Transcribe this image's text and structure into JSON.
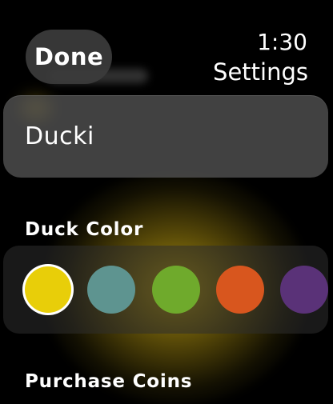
{
  "header": {
    "done_label": "Done",
    "time": "1:30",
    "title": "Settings"
  },
  "name_field": {
    "value": "Ducki"
  },
  "duck_color": {
    "label": "Duck Color",
    "selected_index": 0,
    "swatches": [
      {
        "name": "yellow",
        "color": "#E8CE09"
      },
      {
        "name": "teal",
        "color": "#5E9490"
      },
      {
        "name": "green",
        "color": "#6FAA2C"
      },
      {
        "name": "orange",
        "color": "#D8561E"
      },
      {
        "name": "purple",
        "color": "#5A3278"
      }
    ]
  },
  "purchase_coins": {
    "label": "Purchase Coins"
  },
  "theme": {
    "accent_glow": "#C4A612",
    "card_bg": "#5A5A5A",
    "background": "#000000"
  }
}
